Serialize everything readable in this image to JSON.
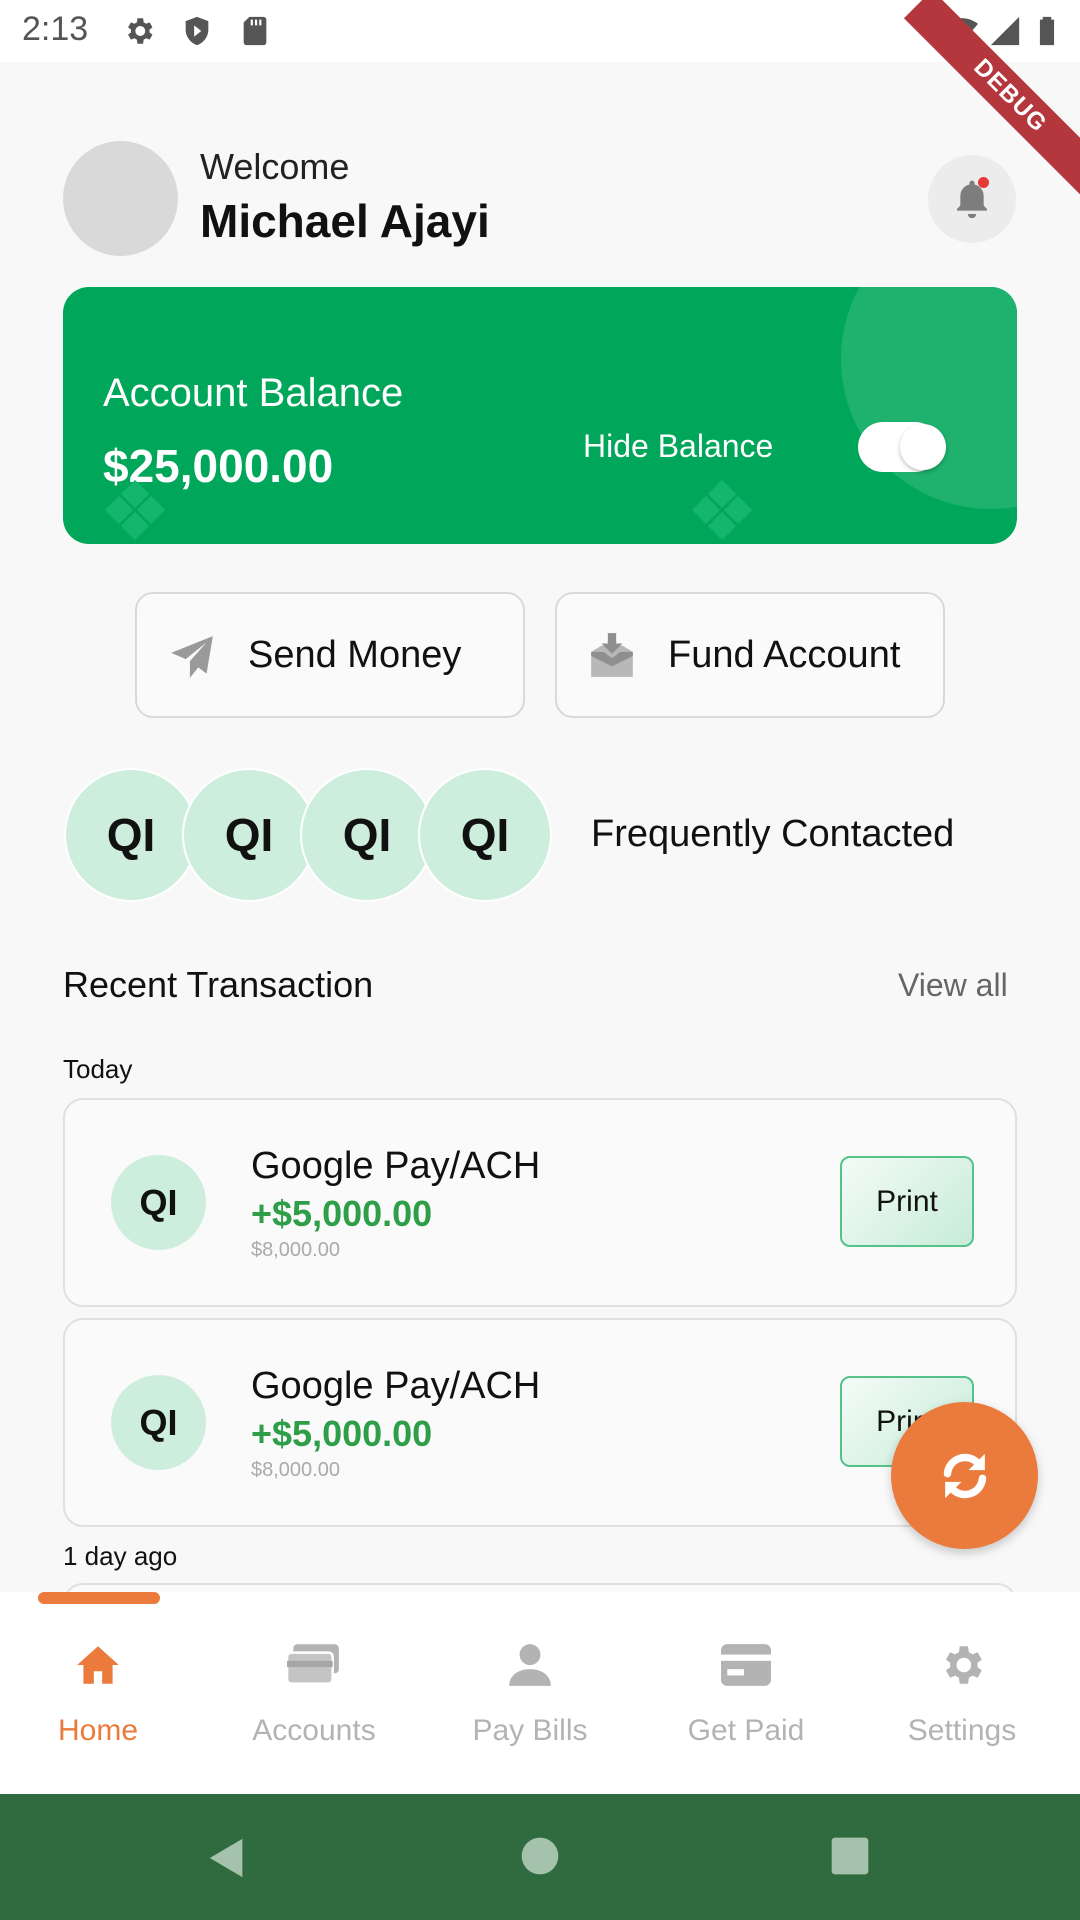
{
  "status_bar": {
    "time": "2:13"
  },
  "debug_banner": "DEBUG",
  "header": {
    "welcome": "Welcome",
    "user_name": "Michael Ajayi"
  },
  "balance_card": {
    "label": "Account Balance",
    "amount": "$25,000.00",
    "hide_label": "Hide Balance",
    "hide_toggle_on": true
  },
  "actions": [
    {
      "label": "Send Money",
      "icon": "paper-plane-icon"
    },
    {
      "label": "Fund Account",
      "icon": "inbox-download-icon"
    }
  ],
  "frequent": {
    "label": "Frequently Contacted",
    "contacts": [
      "QI",
      "QI",
      "QI",
      "QI"
    ]
  },
  "recent": {
    "title": "Recent Transaction",
    "view_all": "View all",
    "groups": [
      {
        "date": "Today",
        "items": [
          {
            "initials": "QI",
            "name": "Google Pay/ACH",
            "amount": "+$5,000.00",
            "balance": "$8,000.00",
            "action": "Print"
          },
          {
            "initials": "QI",
            "name": "Google Pay/ACH",
            "amount": "+$5,000.00",
            "balance": "$8,000.00",
            "action": "Print"
          }
        ]
      },
      {
        "date": "1 day ago",
        "items": []
      }
    ]
  },
  "fab": {
    "icon": "refresh-icon"
  },
  "bottom_nav": {
    "active_index": 0,
    "items": [
      {
        "label": "Home",
        "icon": "home-icon"
      },
      {
        "label": "Accounts",
        "icon": "wallet-icon"
      },
      {
        "label": "Pay Bills",
        "icon": "person-icon"
      },
      {
        "label": "Get Paid",
        "icon": "card-icon"
      },
      {
        "label": "Settings",
        "icon": "gear-icon"
      }
    ]
  },
  "colors": {
    "brand_green": "#00a65a",
    "accent_orange": "#ea7b3c",
    "amount_green": "#2e9e48",
    "contact_bg": "#cdeedd",
    "system_nav": "#2f6b3f"
  }
}
